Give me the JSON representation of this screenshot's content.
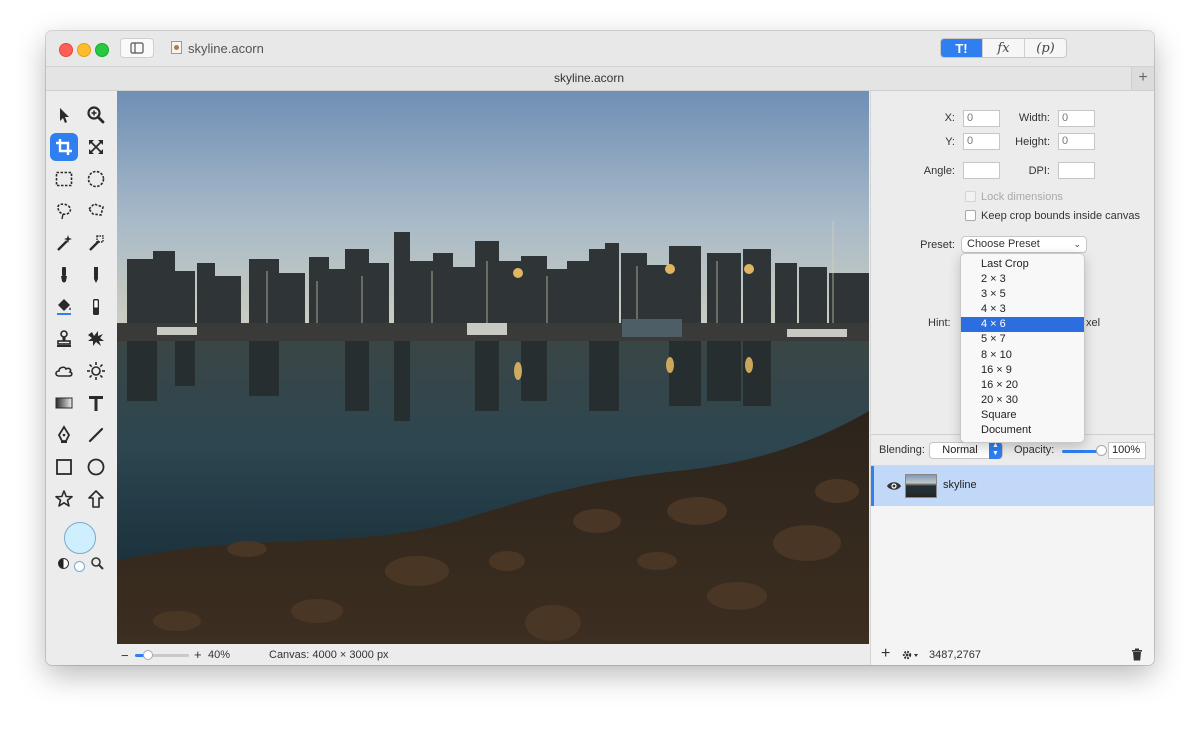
{
  "window": {
    "title": "skyline.acorn",
    "tab_title": "skyline.acorn",
    "tab_add": "+",
    "segments": [
      "T!",
      "fx",
      "(p)"
    ]
  },
  "toolbox": {
    "tools": [
      "select-arrow",
      "zoom",
      "crop",
      "transform",
      "rect-select",
      "ellipse-select",
      "lasso",
      "polygon-lasso",
      "magic-wand",
      "wand-select",
      "brush",
      "pencil",
      "paint-bucket",
      "eraser",
      "clone-stamp",
      "smudge",
      "cloud",
      "sun",
      "gradient",
      "text",
      "pen",
      "line",
      "rectangle",
      "ellipse",
      "star",
      "arrow"
    ],
    "active_tool": "crop"
  },
  "inspector": {
    "x_label": "X:",
    "x_value": "0",
    "y_label": "Y:",
    "y_value": "0",
    "width_label": "Width:",
    "width_value": "0",
    "height_label": "Height:",
    "height_value": "0",
    "angle_label": "Angle:",
    "angle_value": "",
    "dpi_label": "DPI:",
    "dpi_value": "",
    "lock_dimensions": "Lock dimensions",
    "keep_bounds": "Keep crop bounds inside canvas",
    "preset_label": "Preset:",
    "preset_value": "Choose Preset",
    "hint_label": "Hint:",
    "hint_tail": "xel",
    "menu_items": [
      "Last Crop",
      "2 × 3",
      "3 × 5",
      "4 × 3",
      "4 × 6",
      "5 × 7",
      "8 × 10",
      "16 × 9",
      "16 × 20",
      "20 × 30",
      "Square",
      "Document"
    ],
    "menu_selected": "4 × 6"
  },
  "layers": {
    "blending_label": "Blending:",
    "blending_value": "Normal",
    "opacity_label": "Opacity:",
    "opacity_value": "100%",
    "layer_name": "skyline",
    "coords": "3487,2767"
  },
  "bottom": {
    "zoom_minus": "−",
    "zoom_plus": "+",
    "zoom": "40%",
    "canvas_size": "Canvas: 4000 × 3000 px"
  },
  "colors": {
    "accent": "#2f7ff0",
    "menu_highlight": "#2c6de0",
    "layer_selected": "#c2d8f9",
    "fill_color": "#cfeefe"
  }
}
